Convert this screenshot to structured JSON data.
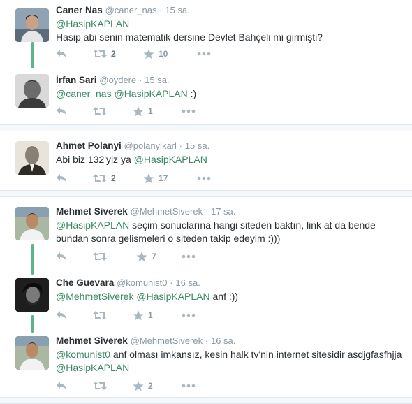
{
  "tweets": [
    {
      "name": "Caner Nas",
      "handle": "@caner_nas",
      "dot": "·",
      "time": "15 sa.",
      "parts": [
        {
          "t": "@HasipKAPLAN",
          "m": true
        },
        {
          "t": "\nHasip abi senin matematik dersine Devlet Bahçeli mi girmişti?",
          "m": false
        }
      ],
      "retweets": "2",
      "likes": "10"
    },
    {
      "name": "İrfan Sari",
      "handle": "@oydere",
      "dot": "·",
      "time": "15 sa.",
      "parts": [
        {
          "t": "@caner_nas",
          "m": true
        },
        {
          "t": " ",
          "m": false
        },
        {
          "t": "@HasipKAPLAN",
          "m": true
        },
        {
          "t": " :)",
          "m": false
        }
      ],
      "retweets": "",
      "likes": "1"
    },
    {
      "name": "Ahmet Polanyi",
      "handle": "@polanyikarl",
      "dot": "·",
      "time": "15 sa.",
      "parts": [
        {
          "t": "Abi biz 132'yiz ya ",
          "m": false
        },
        {
          "t": "@HasipKAPLAN",
          "m": true
        }
      ],
      "retweets": "2",
      "likes": "17"
    },
    {
      "name": "Mehmet Siverek",
      "handle": "@MehmetSiverek",
      "dot": "·",
      "time": "17 sa.",
      "parts": [
        {
          "t": "@HasipKAPLAN",
          "m": true
        },
        {
          "t": " seçim sonuclarına hangi siteden baktın, link at da bende bundan sonra gelismeleri o siteden takip edeyim :)))",
          "m": false
        }
      ],
      "retweets": "",
      "likes": "7"
    },
    {
      "name": "Che Guevara",
      "handle": "@komunist0",
      "dot": "·",
      "time": "16 sa.",
      "parts": [
        {
          "t": "@MehmetSiverek",
          "m": true
        },
        {
          "t": " ",
          "m": false
        },
        {
          "t": "@HasipKAPLAN",
          "m": true
        },
        {
          "t": " anf :))",
          "m": false
        }
      ],
      "retweets": "",
      "likes": "1"
    },
    {
      "name": "Mehmet Siverek",
      "handle": "@MehmetSiverek",
      "dot": "·",
      "time": "16 sa.",
      "parts": [
        {
          "t": "@komunist0",
          "m": true
        },
        {
          "t": " anf olması imkansız, kesin halk tv'nin internet sitesidir asdjgfasfhjja ",
          "m": false
        },
        {
          "t": "@HasipKAPLAN",
          "m": true
        }
      ],
      "retweets": "",
      "likes": "2"
    }
  ],
  "colors": {
    "accent": "#3b8a64",
    "thread": "#5fb389",
    "muted": "#8899a6"
  },
  "icons": [
    "reply-icon",
    "retweet-icon",
    "like-star-icon",
    "more-dots-icon"
  ]
}
